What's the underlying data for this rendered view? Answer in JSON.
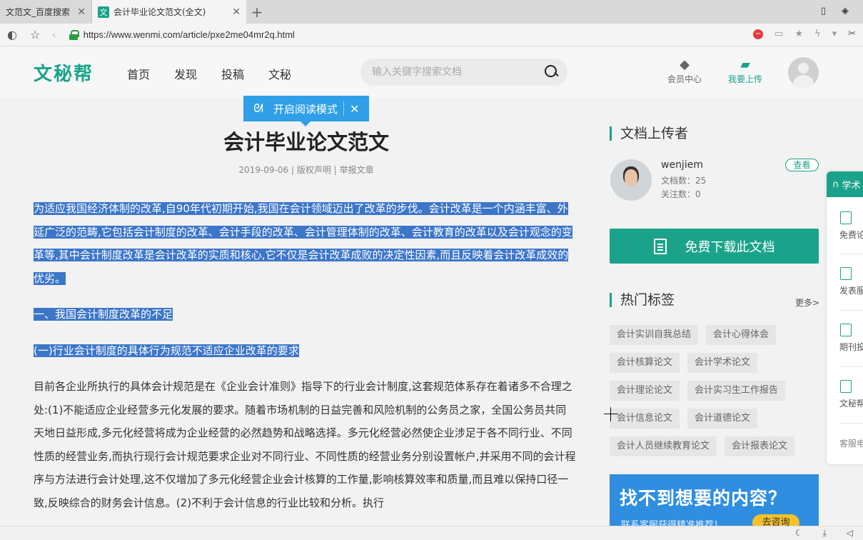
{
  "browser": {
    "tabs": [
      {
        "title": "文范文_百度搜索",
        "close": "✕"
      },
      {
        "title": "会计毕业论文范文(全文)",
        "close": "✕",
        "favicon": "文"
      }
    ],
    "newtab": "+",
    "url": "https://www.wenmi.com/article/pxe2me04mr2q.html"
  },
  "site": {
    "logo": "文秘帮",
    "nav": [
      "首页",
      "发现",
      "投稿",
      "文秘"
    ],
    "search_placeholder": "输入关键字搜索文档",
    "member_label": "会员中心",
    "upload_label": "我要上传"
  },
  "reader_popup": {
    "label": "开启阅读模式"
  },
  "article": {
    "title": "会计毕业论文范文",
    "date": "2019-09-06",
    "copyright": "版权声明",
    "report": "举报文章",
    "paragraphs": [
      "为适应我国经济体制的改革,自90年代初期开始,我国在会计领域迈出了改革的步伐。会计改革是一个内涵丰富、外延广泛的范畴,它包括会计制度的改革、会计手段的改革、会计管理体制的改革、会计教育的改革以及会计观念的变革等,其中会计制度改革是会计改革的实质和核心,它不仅是会计改革成败的决定性因素,而且反映着会计改革成效的优劣。",
      "一、我国会计制度改革的不足",
      "(一)行业会计制度的具体行为规范不适应企业改革的要求",
      "目前各企业所执行的具体会计规范是在《企业会计准则》指导下的行业会计制度,这套规范体系存在着诸多不合理之处:(1)不能适应企业经营多元化发展的要求。随着市场机制的日益完善和风险机制的公务员之家，全国公务员共同天地日益形成,多元化经营将成为企业经营的必然趋势和战略选择。多元化经营必然使企业涉足于各不同行业、不同性质的经营业务,而执行现行会计规范要求企业对不同行业、不同性质的经营业务分别设置帐户,并采用不同的会计程序与方法进行会计处理,这不仅增加了多元化经营企业会计核算的工作量,影响核算效率和质量,而且难以保持口径一致,反映综合的财务会计信息。(2)不利于会计信息的行业比较和分析。执行"
    ]
  },
  "sidebar": {
    "uploader_title": "文档上传者",
    "uploader_name": "wenjiem",
    "doc_count": "文档数：25",
    "follow_count": "关注数：0",
    "view_button": "查看",
    "download_button": "免费下载此文档",
    "tags_title": "热门标签",
    "more": "更多>",
    "tags": [
      "会计实训自我总结",
      "会计心得体会",
      "会计核算论文",
      "会计学术论文",
      "会计理论论文",
      "会计实习生工作报告",
      "会计信息论文",
      "会计道德论文",
      "会计人员继续教育论文",
      "会计报表论文"
    ],
    "promo_title": "找不到想要的内容？",
    "promo_sub": "联系客服获得精准推荐！",
    "promo_button": "去咨询"
  },
  "float_panel": {
    "head": "学术",
    "items": [
      "免费论",
      "发表服",
      "期刊投",
      "文秘帮"
    ],
    "footer": "客服电"
  }
}
